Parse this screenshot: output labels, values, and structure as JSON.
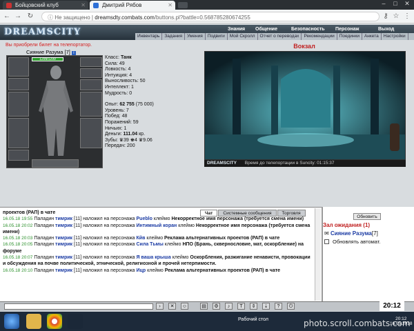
{
  "browser": {
    "tabs": [
      {
        "label": "Бойцовский клуб",
        "active": false
      },
      {
        "label": "Дмитрий Рябов",
        "active": true
      }
    ],
    "security_label": "Не защищено",
    "url_host": "dreamsdty.combats.com",
    "url_path": "/buttons.pl?battle=0.568785280674255"
  },
  "game": {
    "logo": "DREAMSCITY",
    "top_links": [
      "Знания",
      "Общение",
      "Безопасность",
      "Персонаж",
      "Выход"
    ],
    "sub_links": [
      "Инвентарь",
      "Задания",
      "Умения",
      "Подвиги",
      "Мой Скролл",
      "Отчет о переводах",
      "Рекомендации",
      "Поединки",
      "Анкета",
      "Настройки"
    ],
    "purchase_notice": "Вы приобрели билет на телепортатор.",
    "character": {
      "name": "Сияние Разума [7]",
      "hp": "1299/1299",
      "stats": {
        "class_label": "Класс:",
        "class_value": "Танк",
        "strength": "Сила: 49",
        "agility": "Ловкость: 4",
        "intuition": "Интуиция: 4",
        "endurance": "Выносливость: 50",
        "intellect": "Интеллект: 1",
        "wisdom": "Мудрость: 0",
        "exp_label": "Опыт:",
        "exp_value": "62 755",
        "exp_next": "(75 000)",
        "level": "Уровень: 7",
        "wins": "Побед: 48",
        "losses": "Поражений: 59",
        "draws": "Ничьих: 1",
        "money_label": "Деньги:",
        "money_value": "111.04",
        "money_unit": "кр.",
        "teeth": "Зубы: ♛39 ♚4 ♛9.06",
        "transfers": "Передач: 200"
      }
    },
    "location": {
      "title": "Вокзал",
      "brand": "DREAMSCITY",
      "teleport_text": "Время до телепортации в Suncity: 01:15:37"
    },
    "chat": {
      "tabs": [
        "Чат",
        "Системные сообщения",
        "Торговля"
      ],
      "messages": [
        {
          "time": "",
          "pre": "проектов (РАП) в чате",
          "nick": "",
          "post": ""
        },
        {
          "time": "16.05.18 19:55",
          "pre": "Паладин",
          "nick": "тимрик",
          "lvl": "[11]",
          "action": "наложил на персонажа",
          "target": "Pueblo",
          "mark": "клеймо",
          "reason": "Некорректное имя персонажа (требуется смена имени)"
        },
        {
          "time": "16.05.18 20:02",
          "pre": "Паладин",
          "nick": "тимрик",
          "lvl": "[11]",
          "action": "наложил на персонажа",
          "target": "Интимный коран",
          "mark": "клеймо",
          "reason": "Некорректное имя персонажа (требуется смена имени)"
        },
        {
          "time": "16.05.18 20:03",
          "pre": "Паладин",
          "nick": "тимрик",
          "lvl": "[11]",
          "action": "наложил на персонажа",
          "target": "Кйв",
          "mark": "клеймо",
          "reason": "Реклама альтернативных проектов (РАП) в чате"
        },
        {
          "time": "16.05.18 20:05",
          "pre": "Паладин",
          "nick": "тимрик",
          "lvl": "[11]",
          "action": "наложил на персонажа",
          "target": "Сила Тьмы",
          "mark": "клеймо",
          "reason": "НПО (Брань, сквернословие, мат, оскорбление) на форуме"
        },
        {
          "time": "16.05.18 20:07",
          "pre": "Паладин",
          "nick": "тимрик",
          "lvl": "[11]",
          "action": "наложил на персонажа",
          "target": "Я ваша крыша",
          "mark": "клеймо",
          "reason": "Оскорбления, разжигание ненависти, провокации и обсуждения на почве политической, этнической, религиозной и прочей нетерпимости."
        },
        {
          "time": "16.05.18 20:10",
          "pre": "Паладин",
          "nick": "тимрик",
          "lvl": "[11]",
          "action": "наложил на персонажа",
          "target": "Ицр",
          "mark": "клеймо",
          "reason": "Реклама альтернативных проектов (РАП) в чате"
        }
      ]
    },
    "room": {
      "refresh_label": "Обновить",
      "title": "Зал ожидания (1)",
      "member": "Сияние Разума",
      "member_level": "[7]",
      "auto_refresh_label": "Обновлять автомат."
    },
    "clock": "20:12"
  },
  "taskbar": {
    "desktop_label": "Рабочий стол",
    "time": "20:12",
    "date": "16.05.2018",
    "watermark": "photo.scroll.combats.com"
  },
  "colors": {
    "accent_red": "#c02020",
    "nick_blue": "#1a3aa3",
    "time_green": "#2a8f2a"
  }
}
